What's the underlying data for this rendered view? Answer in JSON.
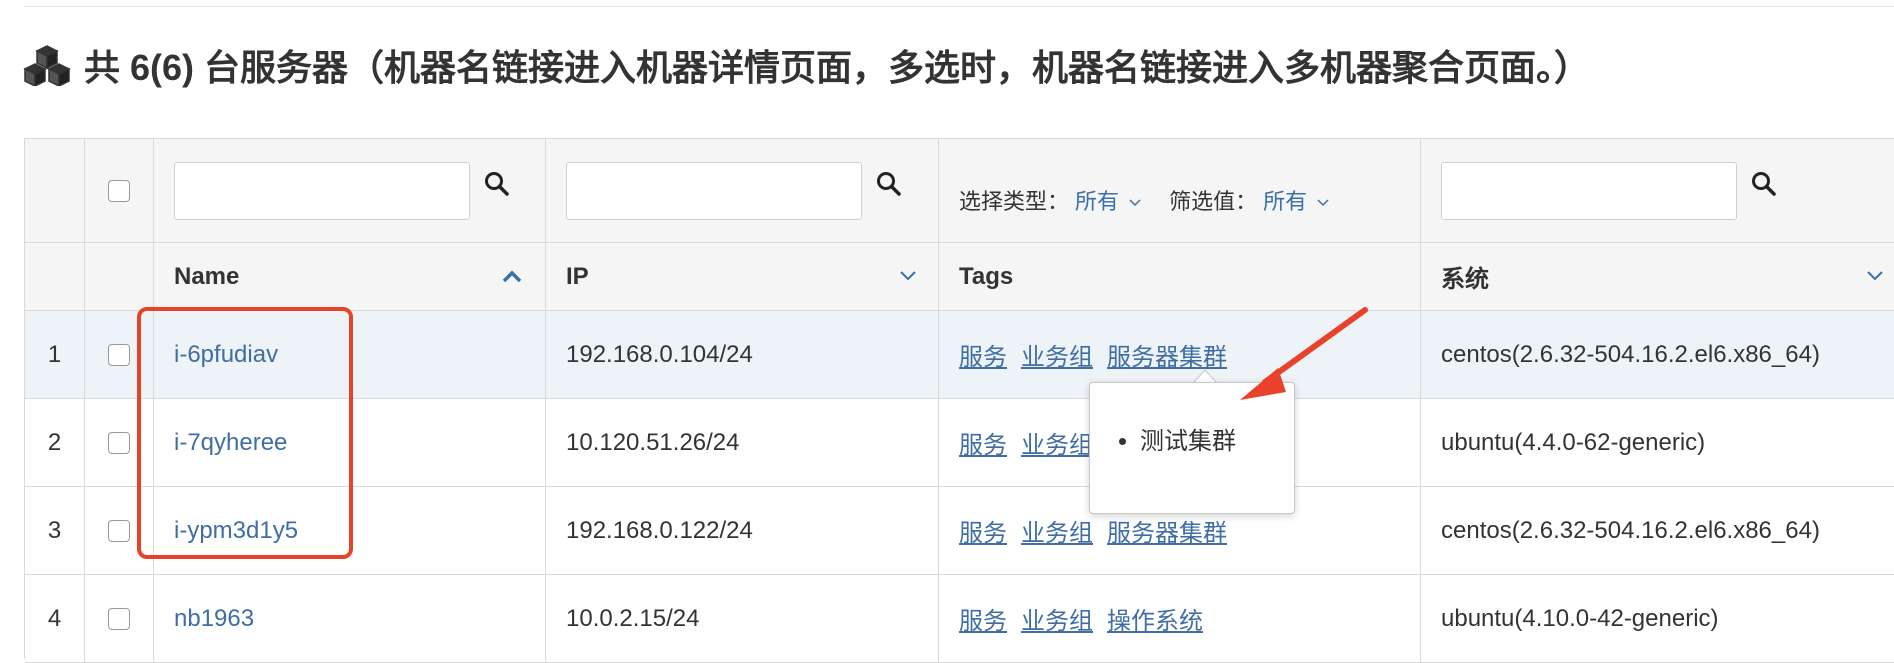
{
  "header": {
    "icon": "cubes-icon",
    "title": "共 6(6) 台服务器（机器名链接进入机器详情页面，多选时，机器名链接进入多机器聚合页面。）"
  },
  "filters": {
    "name_search": {
      "value": "",
      "placeholder": ""
    },
    "ip_search": {
      "value": "",
      "placeholder": ""
    },
    "system_search": {
      "value": "",
      "placeholder": ""
    },
    "tags": {
      "type_label": "选择类型：",
      "type_value": "所有",
      "value_label": "筛选值：",
      "value_value": "所有"
    }
  },
  "columns": {
    "name": "Name",
    "ip": "IP",
    "tags": "Tags",
    "system": "系统"
  },
  "rows": [
    {
      "index": "1",
      "name": "i-6pfudiav",
      "ip": "192.168.0.104/24",
      "tags": [
        "服务",
        "业务组",
        "服务器集群"
      ],
      "system": "centos(2.6.32-504.16.2.el6.x86_64)"
    },
    {
      "index": "2",
      "name": "i-7qyheree",
      "ip": "10.120.51.26/24",
      "tags": [
        "服务",
        "业务组"
      ],
      "system": "ubuntu(4.4.0-62-generic)"
    },
    {
      "index": "3",
      "name": "i-ypm3d1y5",
      "ip": "192.168.0.122/24",
      "tags": [
        "服务",
        "业务组",
        "服务器集群"
      ],
      "system": "centos(2.6.32-504.16.2.el6.x86_64)"
    },
    {
      "index": "4",
      "name": "nb1963",
      "ip": "10.0.2.15/24",
      "tags": [
        "服务",
        "业务组",
        "操作系统"
      ],
      "system": "ubuntu(4.10.0-42-generic)"
    }
  ],
  "popover": {
    "items": [
      "测试集群"
    ]
  },
  "colors": {
    "link": "#3f6ea5",
    "annotation": "#e8432a",
    "row_hover": "#eef3f8"
  }
}
